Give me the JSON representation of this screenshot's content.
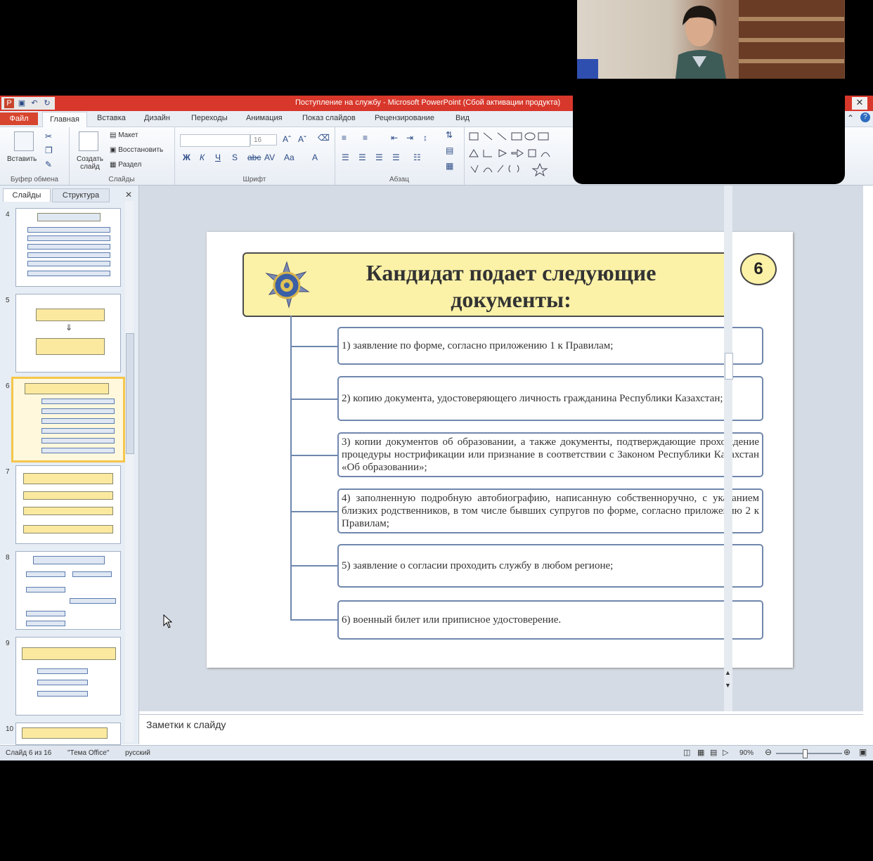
{
  "window": {
    "title": "Поступление на службу - Microsoft PowerPoint (Сбой активации продукта)"
  },
  "ribbon_tabs": {
    "file": "Файл",
    "home": "Главная",
    "insert": "Вставка",
    "design": "Дизайн",
    "transitions": "Переходы",
    "animations": "Анимация",
    "slideshow": "Показ слайдов",
    "review": "Рецензирование",
    "view": "Вид"
  },
  "ribbon": {
    "paste": "Вставить",
    "new_slide": "Создать слайд",
    "layout": "Макет",
    "reset": "Восстановить",
    "section": "Раздел",
    "font_size": "16",
    "groups": {
      "clipboard": "Буфер обмена",
      "slides": "Слайды",
      "font": "Шрифт",
      "paragraph": "Абзац"
    }
  },
  "panel": {
    "tab_slides": "Слайды",
    "tab_outline": "Структура",
    "thumb_numbers": [
      "4",
      "5",
      "6",
      "7",
      "8",
      "9",
      "10"
    ]
  },
  "slide": {
    "number": "6",
    "title": "Кандидат подает следующие документы:",
    "items": [
      "1) заявление по форме, согласно приложению 1 к Правилам;",
      "2) копию документа, удостоверяющего личность гражданина Республики Казахстан;",
      "3) копии документов об образовании, а также документы, подтверждающие прохождение процедуры нострификации или признание в соответствии с Законом Республики Казахстан «Об образовании»;",
      "4) заполненную подробную автобиографию, написанную собственноручно, с указанием близких родственников, в том числе бывших супругов по форме, согласно приложению 2 к Правилам;",
      "5) заявление о согласии проходить службу в любом регионе;",
      "6) военный билет или приписное удостоверение."
    ]
  },
  "notes": {
    "placeholder": "Заметки к слайду"
  },
  "status": {
    "slide": "Слайд 6 из 16",
    "theme": "\"Тема Office\"",
    "language": "русский",
    "zoom": "90%"
  },
  "colors": {
    "titlebar": "#d8372b",
    "slide_header_fill": "#fbf1a7",
    "box_border": "#7087ad"
  }
}
